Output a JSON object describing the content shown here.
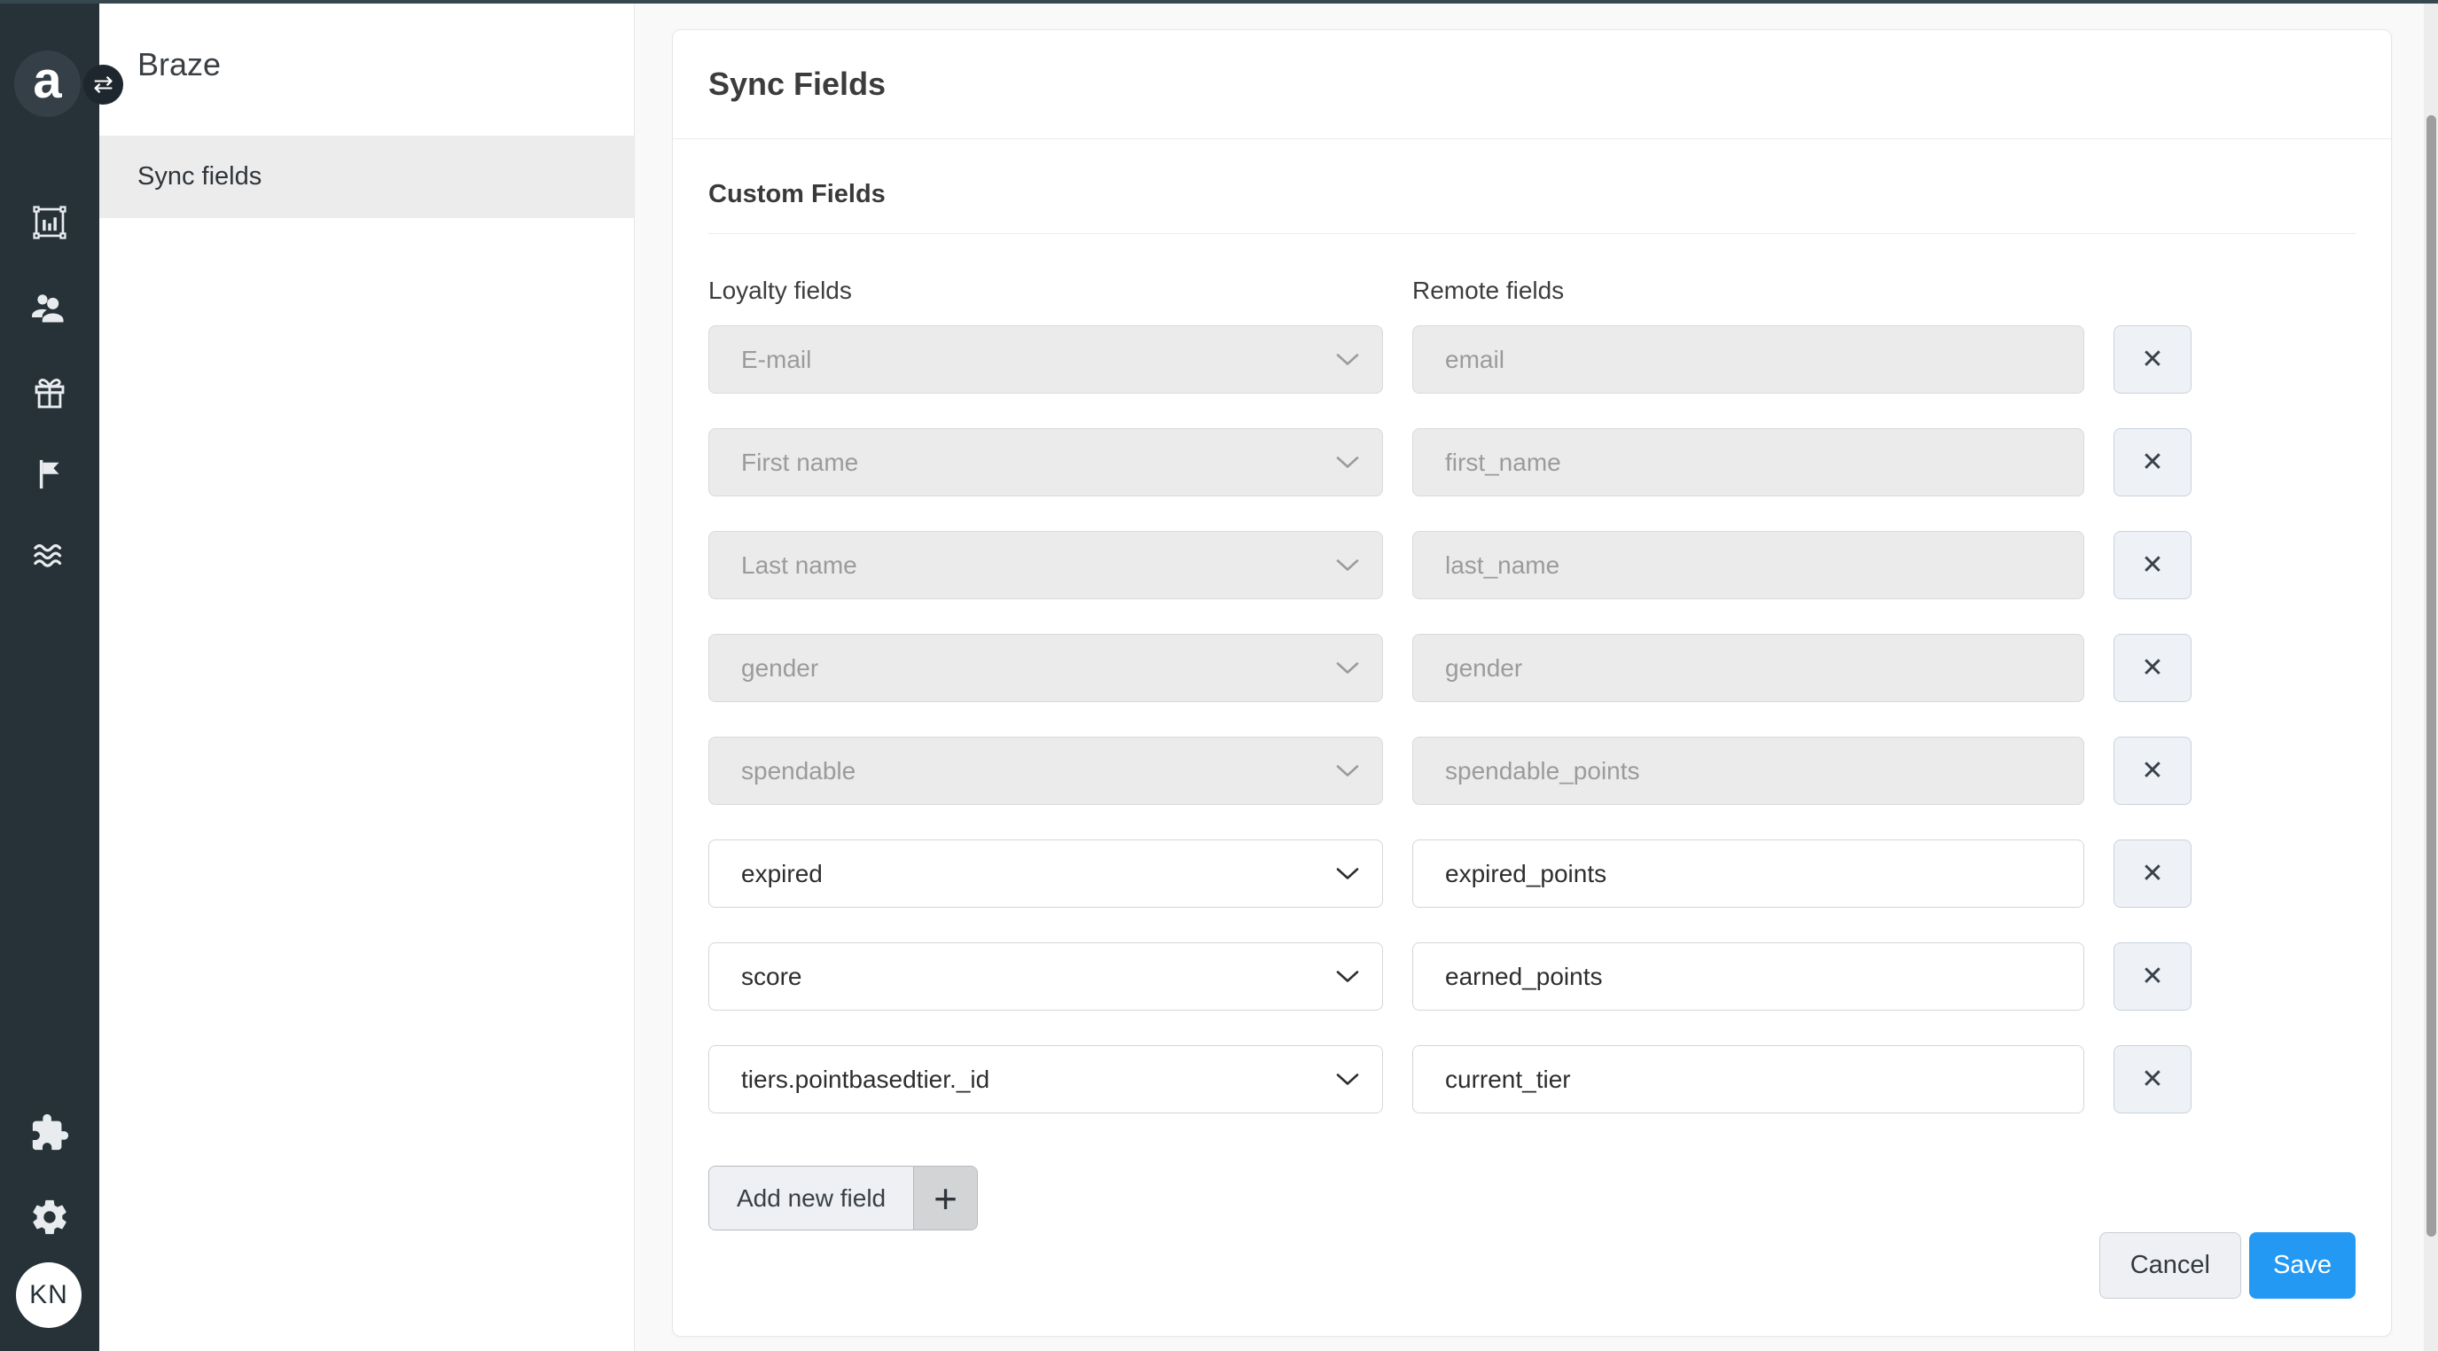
{
  "colors": {
    "accent_blue": "#2499f3",
    "sidebar_bg": "#263238",
    "top_border": "#37474f",
    "selected_row_bg": "#ececec"
  },
  "sidebar": {
    "logo_text": "a",
    "avatar_initials": "KN",
    "icon_names": [
      "analytics-board-icon",
      "customers-icon",
      "gift-icon",
      "flag-icon",
      "waves-icon",
      "puzzle-icon",
      "gear-icon"
    ]
  },
  "icons": {
    "swap": "⇄",
    "close": "✕",
    "plus": "+"
  },
  "panel": {
    "title": "Braze",
    "item_label": "Sync fields"
  },
  "main": {
    "title": "Sync Fields",
    "section_title": "Custom Fields",
    "columns": {
      "loyalty": "Loyalty fields",
      "remote": "Remote fields"
    },
    "rows": [
      {
        "loyalty": "E-mail",
        "remote": "email",
        "disabled": true
      },
      {
        "loyalty": "First name",
        "remote": "first_name",
        "disabled": true
      },
      {
        "loyalty": "Last name",
        "remote": "last_name",
        "disabled": true
      },
      {
        "loyalty": "gender",
        "remote": "gender",
        "disabled": true
      },
      {
        "loyalty": "spendable",
        "remote": "spendable_points",
        "disabled": true
      },
      {
        "loyalty": "expired",
        "remote": "expired_points",
        "disabled": false
      },
      {
        "loyalty": "score",
        "remote": "earned_points",
        "disabled": false
      },
      {
        "loyalty": "tiers.pointbasedtier._id",
        "remote": "current_tier",
        "disabled": false
      }
    ],
    "add_button": {
      "label": "Add new field"
    },
    "footer": {
      "cancel": "Cancel",
      "save": "Save"
    }
  }
}
